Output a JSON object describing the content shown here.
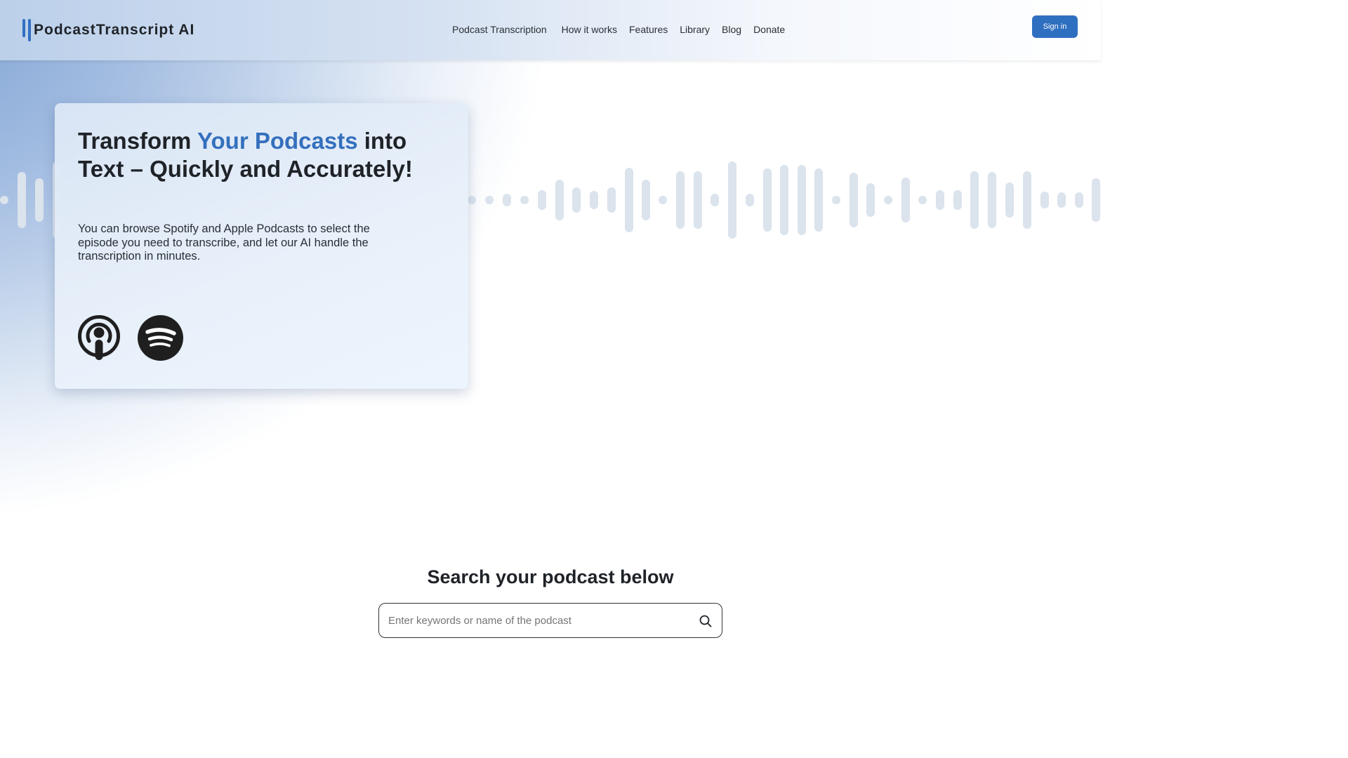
{
  "brand": {
    "name": "PodcastTranscript AI",
    "accent_color": "#3270c2"
  },
  "nav": {
    "items": [
      {
        "label": "Podcast Transcription"
      },
      {
        "label": "How it works"
      },
      {
        "label": "Features"
      },
      {
        "label": "Library"
      },
      {
        "label": "Blog"
      },
      {
        "label": "Donate"
      }
    ],
    "signin_label": "Sign in"
  },
  "hero": {
    "title_part1": "Transform ",
    "title_accent": "Your Podcasts",
    "title_part2": " into Text – Quickly and Accurately!",
    "description": "You can browse Spotify and Apple Podcasts to select the episode you need to transcribe, and let our AI handle the transcription in minutes.",
    "icons": [
      "apple-podcasts-icon",
      "spotify-icon"
    ]
  },
  "search": {
    "title": "Search your podcast below",
    "placeholder": "Enter keywords or name of the podcast",
    "icon": "search-icon"
  },
  "colors": {
    "button_bg": "#2f6fc0",
    "headline_accent": "#3470bd",
    "waveform": "#dbe3ec"
  }
}
